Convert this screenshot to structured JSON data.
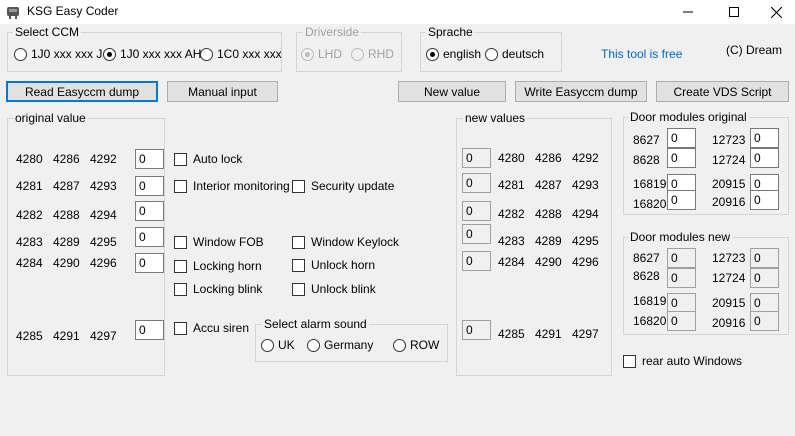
{
  "window": {
    "title": "KSG Easy Coder",
    "minimize_icon": "minimize-icon",
    "maximize_icon": "maximize-icon",
    "close_icon": "close-icon"
  },
  "select_ccm": {
    "label": "Select CCM",
    "options": [
      {
        "label": "1J0 xxx xxx J",
        "checked": false
      },
      {
        "label": "1J0 xxx xxx AH",
        "checked": true
      },
      {
        "label": "1C0 xxx xxx",
        "checked": false
      }
    ]
  },
  "driverside": {
    "label": "Driverside",
    "options": [
      {
        "label": "LHD",
        "checked": true
      },
      {
        "label": "RHD",
        "checked": false
      }
    ]
  },
  "sprache": {
    "label": "Sprache",
    "options": [
      {
        "label": "english",
        "checked": true
      },
      {
        "label": "deutsch",
        "checked": false
      }
    ]
  },
  "info": {
    "free_text": "This tool is free",
    "copyright": "(C) Dream"
  },
  "buttons": {
    "read": "Read Easyccm dump",
    "manual": "Manual input",
    "new_value": "New value",
    "write": "Write Easyccm dump",
    "vds": "Create VDS Script"
  },
  "original_value": {
    "label": "original value",
    "rows": [
      {
        "a": "4280",
        "b": "4286",
        "c": "4292",
        "value": "0"
      },
      {
        "a": "4281",
        "b": "4287",
        "c": "4293",
        "value": "0"
      },
      {
        "a": "4282",
        "b": "4288",
        "c": "4294",
        "value": "0"
      },
      {
        "a": "4283",
        "b": "4289",
        "c": "4295",
        "value": "0"
      },
      {
        "a": "4284",
        "b": "4290",
        "c": "4296",
        "value": "0"
      },
      {
        "a": "4285",
        "b": "4291",
        "c": "4297",
        "value": "0"
      }
    ]
  },
  "options": {
    "auto_lock": "Auto lock",
    "interior_monitoring": "Interior monitoring",
    "security_update": "Security update",
    "window_fob": "Window FOB",
    "window_keylock": "Window Keylock",
    "locking_horn": "Locking horn",
    "unlock_horn": "Unlock horn",
    "locking_blink": "Locking blink",
    "unlock_blink": "Unlock blink",
    "accu_siren": "Accu siren"
  },
  "alarm_sound": {
    "label": "Select alarm sound",
    "options": [
      {
        "label": "UK",
        "checked": false
      },
      {
        "label": "Germany",
        "checked": false
      },
      {
        "label": "ROW",
        "checked": false
      }
    ]
  },
  "new_values": {
    "label": "new values",
    "rows": [
      {
        "value": "0",
        "a": "4280",
        "b": "4286",
        "c": "4292"
      },
      {
        "value": "0",
        "a": "4281",
        "b": "4287",
        "c": "4293"
      },
      {
        "value": "0",
        "a": "4282",
        "b": "4288",
        "c": "4294"
      },
      {
        "value": "0",
        "a": "4283",
        "b": "4289",
        "c": "4295"
      },
      {
        "value": "0",
        "a": "4284",
        "b": "4290",
        "c": "4296"
      },
      {
        "value": "0",
        "a": "4285",
        "b": "4291",
        "c": "4297"
      }
    ]
  },
  "door_original": {
    "label": "Door modules original",
    "fields": [
      {
        "addr": "8627",
        "value": "0"
      },
      {
        "addr": "12723",
        "value": "0"
      },
      {
        "addr": "8628",
        "value": "0"
      },
      {
        "addr": "12724",
        "value": "0"
      },
      {
        "addr": "16819",
        "value": "0"
      },
      {
        "addr": "20915",
        "value": "0"
      },
      {
        "addr": "16820",
        "value": "0"
      },
      {
        "addr": "20916",
        "value": "0"
      }
    ]
  },
  "door_new": {
    "label": "Door modules new",
    "fields": [
      {
        "addr": "8627",
        "value": "0"
      },
      {
        "addr": "12723",
        "value": "0"
      },
      {
        "addr": "8628",
        "value": "0"
      },
      {
        "addr": "12724",
        "value": "0"
      },
      {
        "addr": "16819",
        "value": "0"
      },
      {
        "addr": "20915",
        "value": "0"
      },
      {
        "addr": "16820",
        "value": "0"
      },
      {
        "addr": "20916",
        "value": "0"
      }
    ]
  },
  "rear_auto_windows": "rear auto Windows"
}
